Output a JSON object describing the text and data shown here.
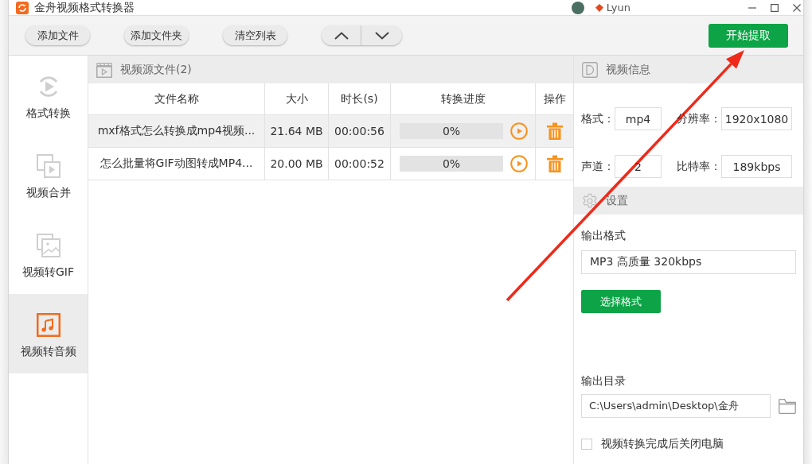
{
  "window": {
    "title": "金舟视频格式转换器",
    "user": "Lyun"
  },
  "toolbar": {
    "buttons": [
      "添加文件",
      "添加文件夹",
      "清空列表"
    ],
    "start_button": "开始提取"
  },
  "sidebar": {
    "items": [
      {
        "label": "格式转换",
        "selected": false
      },
      {
        "label": "视频合并",
        "selected": false
      },
      {
        "label": "视频转GIF",
        "selected": false
      },
      {
        "label": "视频转音频",
        "selected": true
      }
    ]
  },
  "file_list": {
    "title": "视频源文件(2)",
    "columns": [
      "文件名称",
      "大小",
      "时长(s)",
      "转换进度",
      "操作"
    ],
    "rows": [
      {
        "name": "mxf格式怎么转换成mp4视频...",
        "size": "21.64 MB",
        "duration": "00:00:56",
        "level": 0,
        "progress": "0%",
        "selected": true
      },
      {
        "name": "怎么批量将GIF动图转成MP4...",
        "size": "20.00 MB",
        "duration": "00:00:52",
        "level": 0,
        "progress": "0%",
        "selected": false
      }
    ]
  },
  "video_info": {
    "title": "视频信息",
    "fields": [
      {
        "label": "格式：",
        "value": "mp4"
      },
      {
        "label": "分辨率：",
        "value": "1920x1080"
      },
      {
        "label": "声道：",
        "value": "2"
      },
      {
        "label": "比特率：",
        "value": "189kbps"
      }
    ]
  },
  "settings": {
    "title": "设置",
    "output_format_label": "输出格式",
    "output_format": "MP3 高质量 320kbps",
    "choose_button": "选择格式",
    "output_dir_label": "输出目录",
    "output_dir": "C:\\Users\\admin\\Desktop\\金舟",
    "shutdown": {
      "label": "视频转换完成后关闭电脑",
      "checked": false
    }
  }
}
